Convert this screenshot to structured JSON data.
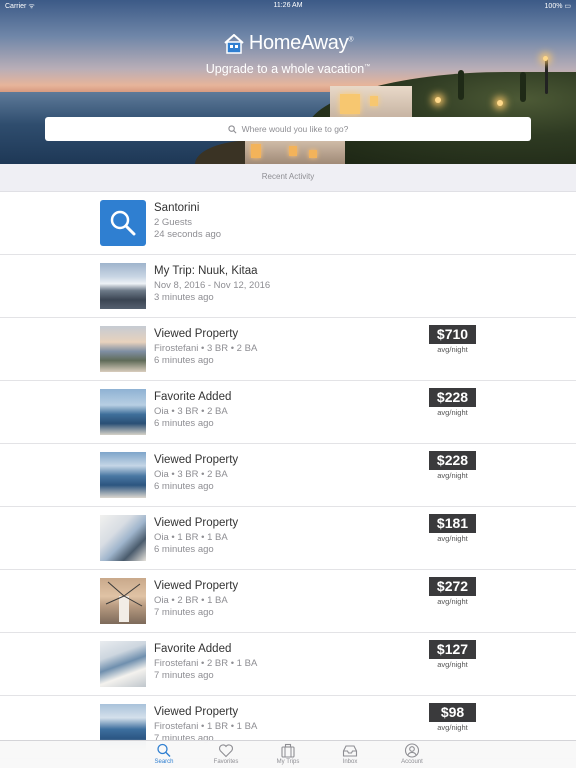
{
  "status_bar": {
    "carrier": "Carrier ᯤ",
    "time": "11:26 AM",
    "battery": "100% ▭"
  },
  "brand": {
    "logo_text": "HomeAway",
    "logo_mark": "®",
    "tagline": "Upgrade to a whole vacation",
    "tagline_mark": "™",
    "accent": "#2f7fd1"
  },
  "search": {
    "placeholder": "Where would you like to go?"
  },
  "recent_activity": {
    "header": "Recent Activity"
  },
  "activity": [
    {
      "title": "Santorini",
      "subtitle": "2 Guests",
      "time": "24 seconds ago",
      "thumb": "search-icon",
      "price": "",
      "price_unit": ""
    },
    {
      "title": "My Trip: Nuuk, Kitaa",
      "subtitle": "Nov 8, 2016 - Nov 12, 2016",
      "time": "3 minutes ago",
      "thumb": "snowy-mountain-photo",
      "price": "",
      "price_unit": ""
    },
    {
      "title": "Viewed Property",
      "subtitle": "Firostefani  • 3 BR • 2 BA",
      "time": "6 minutes ago",
      "thumb": "sunset-terrace-photo",
      "price": "$710",
      "price_unit": "avg/night"
    },
    {
      "title": "Favorite Added",
      "subtitle": "Oia  • 3 BR • 2 BA",
      "time": "6 minutes ago",
      "thumb": "caldera-view-photo",
      "price": "$228",
      "price_unit": "avg/night"
    },
    {
      "title": "Viewed Property",
      "subtitle": "Oia  • 3 BR • 2 BA",
      "time": "6 minutes ago",
      "thumb": "caldera-view-photo",
      "price": "$228",
      "price_unit": "avg/night"
    },
    {
      "title": "Viewed Property",
      "subtitle": "Oia  • 1 BR • 1 BA",
      "time": "6 minutes ago",
      "thumb": "white-villa-photo",
      "price": "$181",
      "price_unit": "avg/night"
    },
    {
      "title": "Viewed Property",
      "subtitle": "Oia  • 2 BR • 1 BA",
      "time": "7 minutes ago",
      "thumb": "windmill-photo",
      "price": "$272",
      "price_unit": "avg/night"
    },
    {
      "title": "Favorite Added",
      "subtitle": "Firostefani  • 2 BR • 1 BA",
      "time": "7 minutes ago",
      "thumb": "cliff-village-photo",
      "price": "$127",
      "price_unit": "avg/night"
    },
    {
      "title": "Viewed Property",
      "subtitle": "Firostefani  • 1 BR • 1 BA",
      "time": "7 minutes ago",
      "thumb": "sea-view-photo",
      "price": "$98",
      "price_unit": "avg/night"
    }
  ],
  "tabs": [
    {
      "label": "Search",
      "icon": "search-icon",
      "active": true
    },
    {
      "label": "Favorites",
      "icon": "heart-icon",
      "active": false
    },
    {
      "label": "My Trips",
      "icon": "suitcase-icon",
      "active": false
    },
    {
      "label": "Inbox",
      "icon": "inbox-icon",
      "active": false
    },
    {
      "label": "Account",
      "icon": "account-icon",
      "active": false
    }
  ]
}
